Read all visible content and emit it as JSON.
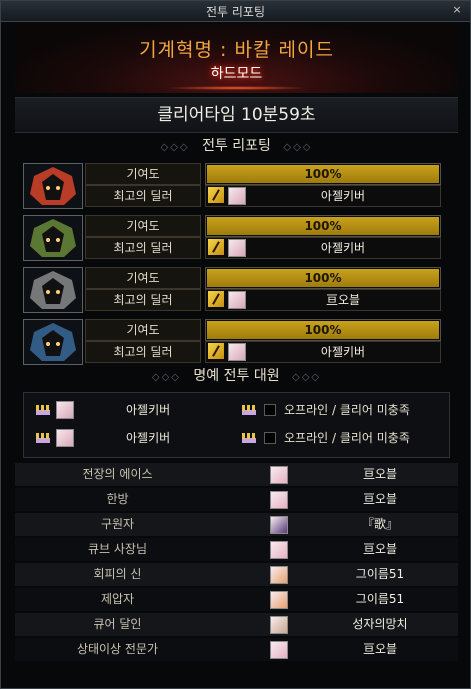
{
  "window": {
    "title": "전투 리포팅",
    "close": "×"
  },
  "raid": {
    "name": "기계혁명 : 바칼 레이드",
    "difficulty": "하드모드"
  },
  "clear_time": "클리어타임   10분59초",
  "sections": {
    "report": "전투 리포팅",
    "honor": "명예 전투 대원",
    "deco": "◇◇◇"
  },
  "players": [
    {
      "contribution_label": "기여도",
      "contribution_value": "100%",
      "contribution_fraction": 1.0,
      "dealer_label": "최고의 딜러",
      "dealer_name": "아젤키버",
      "color": "#d8442a"
    },
    {
      "contribution_label": "기여도",
      "contribution_value": "100%",
      "contribution_fraction": 1.0,
      "dealer_label": "최고의 딜러",
      "dealer_name": "아젤키버",
      "color": "#6a8a3a"
    },
    {
      "contribution_label": "기여도",
      "contribution_value": "100%",
      "contribution_fraction": 1.0,
      "dealer_label": "최고의 딜러",
      "dealer_name": "亘오블",
      "color": "#8a8a8a"
    },
    {
      "contribution_label": "기여도",
      "contribution_value": "100%",
      "contribution_fraction": 1.0,
      "dealer_label": "최고의 딜러",
      "dealer_name": "아젤키버",
      "color": "#3a6a9a"
    }
  ],
  "honor": [
    {
      "name": "아젤키버",
      "status": "오프라인 / 클리어 미충족"
    },
    {
      "name": "아젤키버",
      "status": "오프라인 / 클리어 미충족"
    }
  ],
  "awards": [
    {
      "title": "전장의 에이스",
      "name": "亘오블",
      "face": "#e8b0c4"
    },
    {
      "title": "한방",
      "name": "亘오블",
      "face": "#e8b0c4"
    },
    {
      "title": "구원자",
      "name": "『歌』",
      "face": "#5a3a7a"
    },
    {
      "title": "큐브 사장님",
      "name": "亘오블",
      "face": "#e8b0c4"
    },
    {
      "title": "회피의 신",
      "name": "그이름51",
      "face": "#e8a070"
    },
    {
      "title": "제압자",
      "name": "그이름51",
      "face": "#e8a070"
    },
    {
      "title": "큐어 달인",
      "name": "성자의망치",
      "face": "#c8a890"
    },
    {
      "title": "상태이상 전문가",
      "name": "亘오블",
      "face": "#e8b0c4"
    }
  ]
}
